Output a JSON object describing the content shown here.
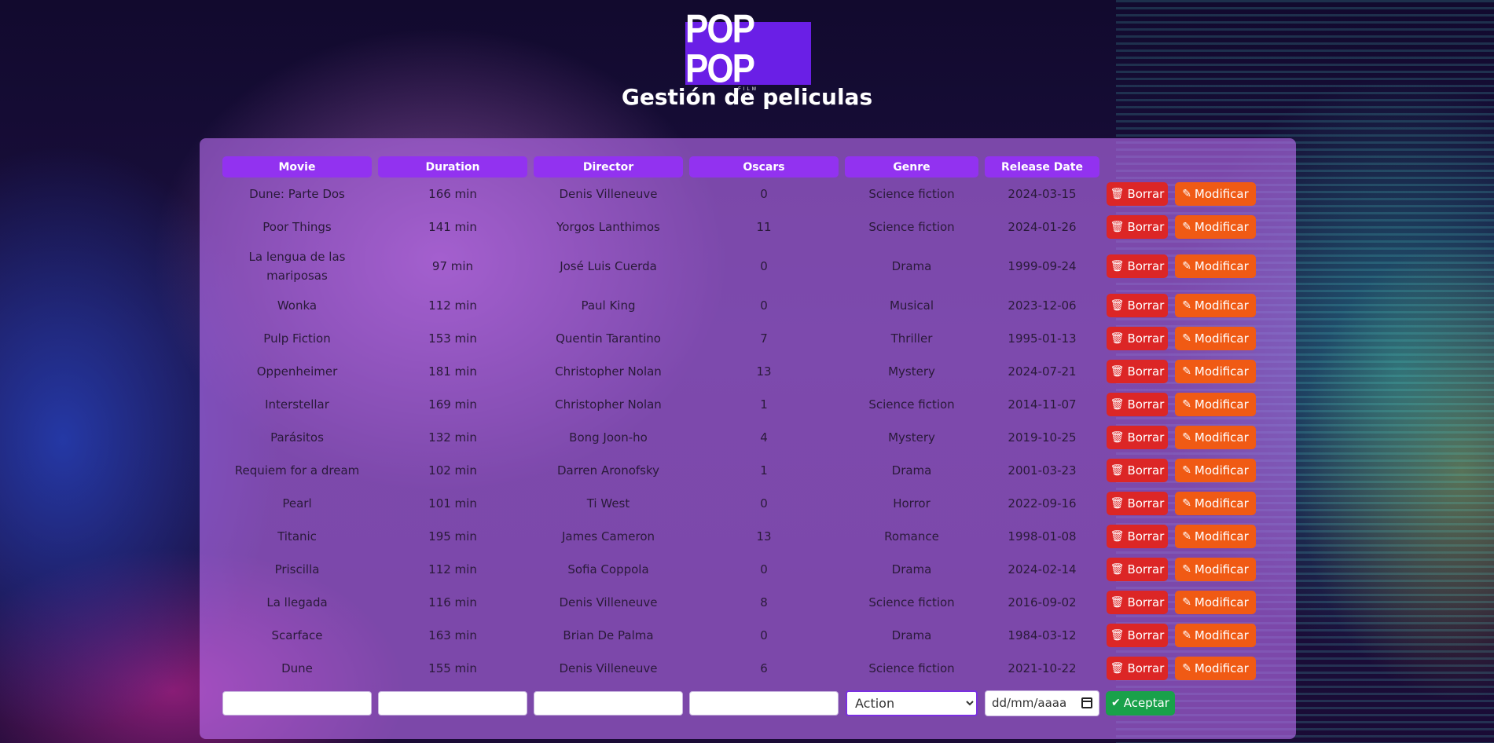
{
  "logo": {
    "text": "POP POP",
    "sub": "FILM"
  },
  "page": {
    "title": "Gestión de peliculas"
  },
  "table": {
    "headers": [
      "Movie",
      "Duration",
      "Director",
      "Oscars",
      "Genre",
      "Release Date"
    ],
    "delete_label": "Borrar",
    "modify_label": "Modificar",
    "rows": [
      [
        "Dune: Parte Dos",
        "166 min",
        "Denis Villeneuve",
        "0",
        "Science fiction",
        "2024-03-15"
      ],
      [
        "Poor Things",
        "141 min",
        "Yorgos Lanthimos",
        "11",
        "Science fiction",
        "2024-01-26"
      ],
      [
        "La lengua de las mariposas",
        "97 min",
        "José Luis Cuerda",
        "0",
        "Drama",
        "1999-09-24"
      ],
      [
        "Wonka",
        "112 min",
        "Paul King",
        "0",
        "Musical",
        "2023-12-06"
      ],
      [
        "Pulp Fiction",
        "153 min",
        "Quentin Tarantino",
        "7",
        "Thriller",
        "1995-01-13"
      ],
      [
        "Oppenheimer",
        "181 min",
        "Christopher Nolan",
        "13",
        "Mystery",
        "2024-07-21"
      ],
      [
        "Interstellar",
        "169 min",
        "Christopher Nolan",
        "1",
        "Science fiction",
        "2014-11-07"
      ],
      [
        "Parásitos",
        "132 min",
        "Bong Joon-ho",
        "4",
        "Mystery",
        "2019-10-25"
      ],
      [
        "Requiem for a dream",
        "102 min",
        "Darren Aronofsky",
        "1",
        "Drama",
        "2001-03-23"
      ],
      [
        "Pearl",
        "101 min",
        "Ti West",
        "0",
        "Horror",
        "2022-09-16"
      ],
      [
        "Titanic",
        "195 min",
        "James Cameron",
        "13",
        "Romance",
        "1998-01-08"
      ],
      [
        "Priscilla",
        "112 min",
        "Sofia Coppola",
        "0",
        "Drama",
        "2024-02-14"
      ],
      [
        "La llegada",
        "116 min",
        "Denis Villeneuve",
        "8",
        "Science fiction",
        "2016-09-02"
      ],
      [
        "Scarface",
        "163 min",
        "Brian De Palma",
        "0",
        "Drama",
        "1984-03-12"
      ],
      [
        "Dune",
        "155 min",
        "Denis Villeneuve",
        "6",
        "Science fiction",
        "2021-10-22"
      ]
    ]
  },
  "form": {
    "movie_value": "",
    "duration_value": "",
    "director_value": "",
    "oscars_value": "",
    "genre_selected": "Action",
    "date_placeholder": "dd/mm/aaaa",
    "accept_label": "Aceptar"
  },
  "icons": {
    "delete": "trash-icon",
    "modify": "pencil-icon",
    "accept": "check-icon",
    "date": "calendar-icon"
  },
  "colors": {
    "accent": "#9232f0",
    "logo_bg": "#6a1fe6",
    "delete_btn": "#dc2626",
    "modify_btn": "#f05a14",
    "accept_btn": "#19a14a"
  }
}
